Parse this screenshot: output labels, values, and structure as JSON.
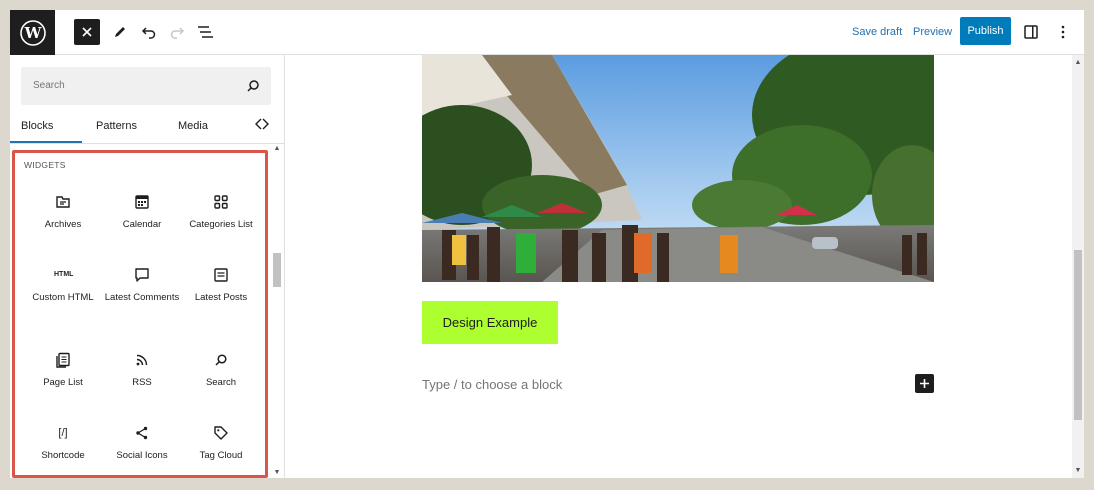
{
  "toolbar": {
    "save_draft": "Save draft",
    "preview": "Preview",
    "publish": "Publish"
  },
  "inserter": {
    "search_placeholder": "Search",
    "tabs": [
      "Blocks",
      "Patterns",
      "Media"
    ],
    "active_tab": "Blocks",
    "section_title": "WIDGETS",
    "blocks": [
      {
        "label": "Archives",
        "icon": "archive-icon"
      },
      {
        "label": "Calendar",
        "icon": "calendar-icon"
      },
      {
        "label": "Categories List",
        "icon": "categories-icon"
      },
      {
        "label": "Custom HTML",
        "icon": "html-icon",
        "icon_text": "HTML"
      },
      {
        "label": "Latest Comments",
        "icon": "comment-icon"
      },
      {
        "label": "Latest Posts",
        "icon": "latest-posts-icon"
      },
      {
        "label": "Page List",
        "icon": "page-list-icon"
      },
      {
        "label": "RSS",
        "icon": "rss-icon"
      },
      {
        "label": "Search",
        "icon": "search-icon"
      },
      {
        "label": "Shortcode",
        "icon": "shortcode-icon",
        "icon_text": "[/]"
      },
      {
        "label": "Social Icons",
        "icon": "share-icon"
      },
      {
        "label": "Tag Cloud",
        "icon": "tag-icon"
      }
    ]
  },
  "editor": {
    "button_text": "Design Example",
    "placeholder": "Type / to choose a block"
  },
  "colors": {
    "accent": "#007cba",
    "highlight_border": "#d9574a",
    "button_bg": "#adff2f"
  }
}
